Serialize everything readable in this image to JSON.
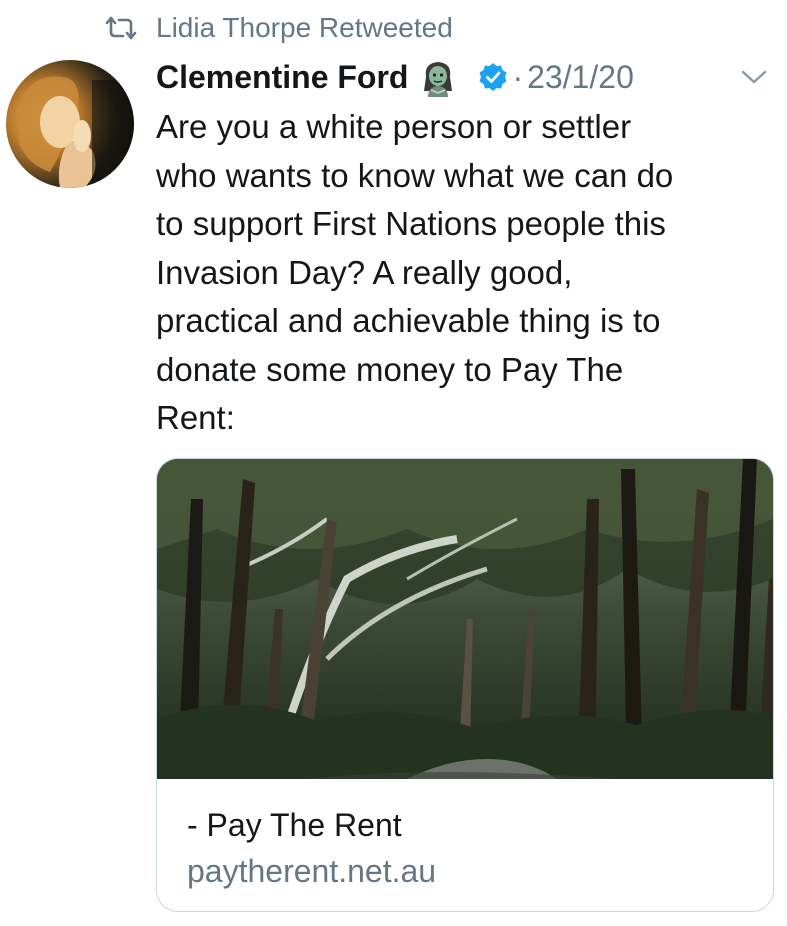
{
  "retweet": {
    "icon": "retweet-icon",
    "label": "Lidia Thorpe Retweeted"
  },
  "tweet": {
    "author_name": "Clementine Ford",
    "author_emoji": "zombie-woman-emoji",
    "verified": true,
    "separator": "·",
    "date": "23/1/20",
    "menu_icon": "chevron-down-icon",
    "text": "Are you a white person or settler\nwho wants to know what we can do\nto support First Nations people this\nInvasion Day? A really good,\npractical and achievable thing is to\ndonate some money to Pay The\nRent:"
  },
  "card": {
    "image": "forest-road-photo",
    "title": "- Pay The Rent",
    "domain": "paytherent.net.au"
  },
  "colors": {
    "secondary_text": "#657786",
    "verified_blue": "#1da1f2",
    "text": "#14171a",
    "card_border": "#ccd6dd"
  }
}
